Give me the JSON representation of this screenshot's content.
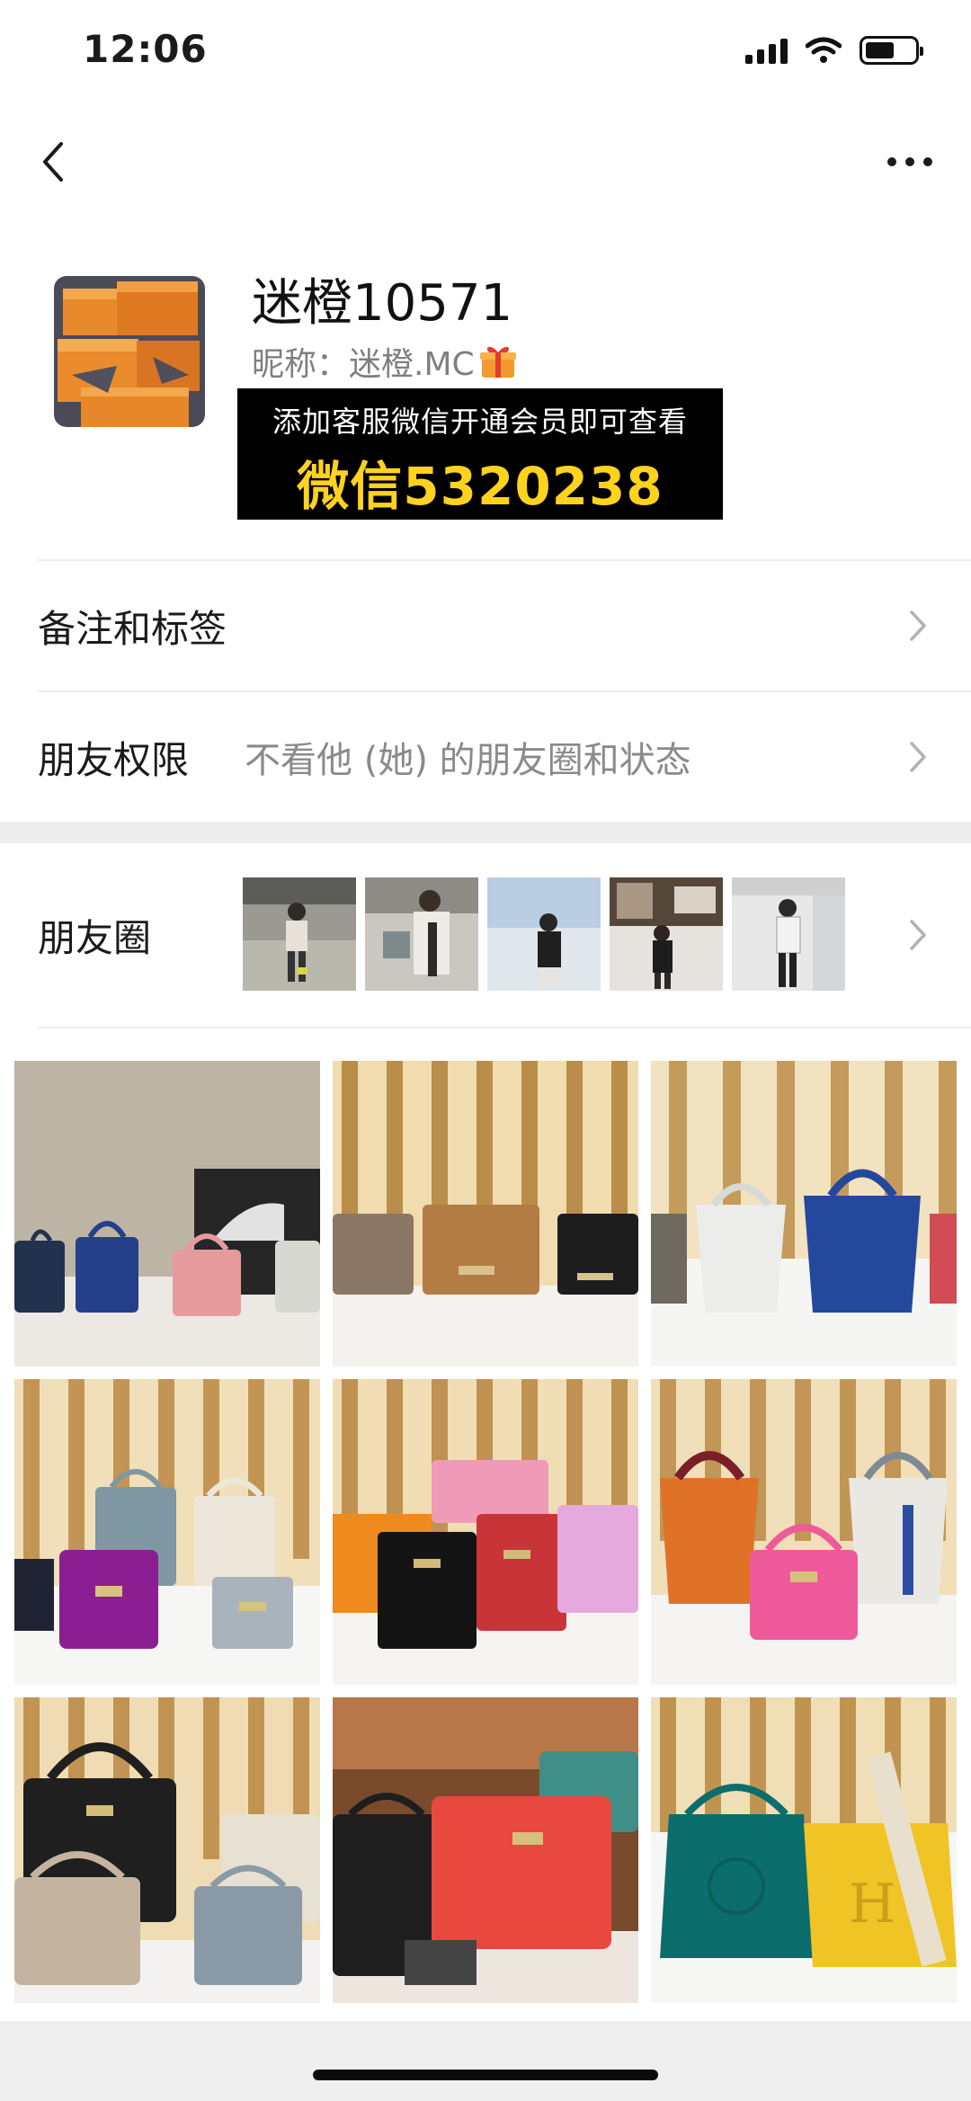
{
  "status_bar": {
    "time": "12:06",
    "icons": [
      "signal-icon",
      "wifi-icon",
      "battery-icon"
    ]
  },
  "nav": {
    "back_icon": "back-chevron-icon",
    "more_icon": "more-dots-icon"
  },
  "profile": {
    "name": "迷橙10571",
    "nickname": "昵称：迷橙.MC",
    "nickname_emoji": "gift-icon"
  },
  "promo": {
    "line1": "添加客服微信开通会员即可查看",
    "line2": "微信5320238",
    "text_color": "#ffffff",
    "highlight_color": "#ffd21e"
  },
  "rows": {
    "remark": {
      "label": "备注和标签"
    },
    "permission": {
      "label": "朋友权限",
      "value": "不看他 (她) 的朋友圈和状态"
    },
    "moments": {
      "label": "朋友圈"
    }
  },
  "colors": {
    "label_text": "#1b1b1b",
    "secondary_text": "#8a8a8a",
    "section_gap": "#ededed"
  }
}
